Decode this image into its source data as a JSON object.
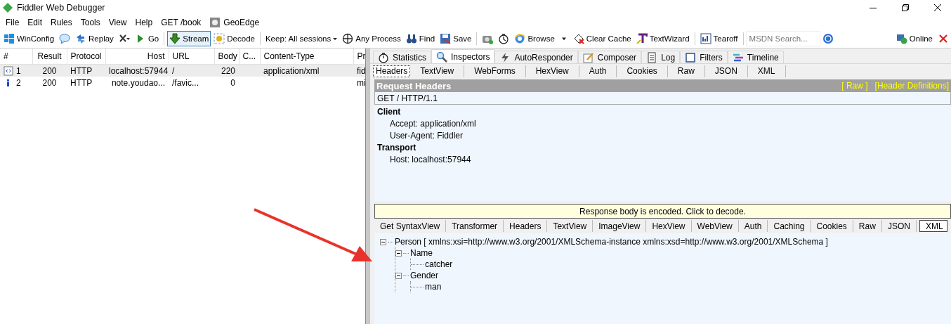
{
  "window": {
    "title": "Fiddler Web Debugger"
  },
  "menu": [
    {
      "kind": "menu",
      "label": "File"
    },
    {
      "kind": "menu",
      "label": "Edit"
    },
    {
      "kind": "menu",
      "label": "Rules"
    },
    {
      "kind": "menu",
      "label": "Tools"
    },
    {
      "kind": "menu",
      "label": "View"
    },
    {
      "kind": "menu",
      "label": "Help"
    },
    {
      "kind": "menu",
      "label": "GET /book"
    },
    {
      "kind": "icon",
      "label": "GeoEdge"
    }
  ],
  "toolbar": [
    {
      "kind": "button",
      "label": "WinConfig"
    },
    {
      "kind": "icon"
    },
    {
      "kind": "button",
      "label": "Replay"
    },
    {
      "kind": "menu-icon"
    },
    {
      "kind": "button",
      "label": "Go"
    },
    {
      "kind": "separator"
    },
    {
      "kind": "toggle",
      "label": "Stream",
      "selected": true
    },
    {
      "kind": "toggle",
      "label": "Decode",
      "selected": false
    },
    {
      "kind": "separator"
    },
    {
      "kind": "dropdown",
      "label": "Keep: All sessions"
    },
    {
      "kind": "button",
      "label": "Any Process"
    },
    {
      "kind": "button",
      "label": "Find"
    },
    {
      "kind": "button",
      "label": "Save"
    },
    {
      "kind": "separator"
    },
    {
      "kind": "icon"
    },
    {
      "kind": "icon"
    },
    {
      "kind": "button",
      "label": "Browse"
    },
    {
      "kind": "menu-icon"
    },
    {
      "kind": "button",
      "label": "Clear Cache"
    },
    {
      "kind": "button",
      "label": "TextWizard"
    },
    {
      "kind": "separator"
    },
    {
      "kind": "button",
      "label": "Tearoff"
    },
    {
      "kind": "separator"
    },
    {
      "kind": "field",
      "placeholder": "MSDN Search..."
    },
    {
      "kind": "icon"
    },
    {
      "kind": "spacer"
    },
    {
      "kind": "button",
      "label": "Online"
    },
    {
      "kind": "icon"
    }
  ],
  "sessions": {
    "columns": [
      {
        "label": "#"
      },
      {
        "label": "Result"
      },
      {
        "label": "Protocol"
      },
      {
        "label": "Host"
      },
      {
        "label": "URL"
      },
      {
        "label": "Body"
      },
      {
        "label": "C..."
      },
      {
        "label": "Content-Type"
      },
      {
        "label": "Pr"
      }
    ],
    "rows": [
      {
        "kind": "xml",
        "selected": true,
        "cells": [
          "1",
          "200",
          "HTTP",
          "localhost:57944",
          "/",
          "220",
          "",
          "application/xml",
          "fid"
        ]
      },
      {
        "kind": "info",
        "selected": false,
        "cells": [
          "2",
          "200",
          "HTTP",
          "note.youdao...",
          "/favic...",
          "0",
          "",
          "",
          "mi"
        ]
      }
    ]
  },
  "tabs": [
    {
      "label": "Statistics",
      "selected": false
    },
    {
      "label": "Inspectors",
      "selected": true
    },
    {
      "label": "AutoResponder",
      "selected": false
    },
    {
      "label": "Composer",
      "selected": false
    },
    {
      "label": "Log",
      "selected": false
    },
    {
      "label": "Filters",
      "selected": false
    },
    {
      "label": "Timeline",
      "selected": false
    }
  ],
  "request": {
    "tabs": [
      {
        "label": "Headers",
        "selected": true
      },
      {
        "label": "TextView",
        "selected": false
      },
      {
        "label": "WebForms",
        "selected": false
      },
      {
        "label": "HexView",
        "selected": false
      },
      {
        "label": "Auth",
        "selected": false
      },
      {
        "label": "Cookies",
        "selected": false
      },
      {
        "label": "Raw",
        "selected": false
      },
      {
        "label": "JSON",
        "selected": false
      },
      {
        "label": "XML",
        "selected": false
      }
    ],
    "title": "Request Headers",
    "links": [
      "[ Raw ]",
      "[Header Definitions]"
    ],
    "request_line": "GET / HTTP/1.1",
    "groups": [
      {
        "name": "Client",
        "headers": [
          "Accept: application/xml",
          "User-Agent: Fiddler"
        ]
      },
      {
        "name": "Transport",
        "headers": [
          "Host: localhost:57944"
        ]
      }
    ]
  },
  "response": {
    "banner": "Response body is encoded. Click to decode.",
    "tabs": [
      {
        "label": "Get SyntaxView",
        "selected": false
      },
      {
        "label": "Transformer",
        "selected": false
      },
      {
        "label": "Headers",
        "selected": false
      },
      {
        "label": "TextView",
        "selected": false
      },
      {
        "label": "ImageView",
        "selected": false
      },
      {
        "label": "HexView",
        "selected": false
      },
      {
        "label": "WebView",
        "selected": false
      },
      {
        "label": "Auth",
        "selected": false
      },
      {
        "label": "Caching",
        "selected": false
      },
      {
        "label": "Cookies",
        "selected": false
      },
      {
        "label": "Raw",
        "selected": false
      },
      {
        "label": "JSON",
        "selected": false
      },
      {
        "label": "XML",
        "selected": true
      }
    ],
    "tree": [
      {
        "label": "Person [ xmlns:xsi=http://www.w3.org/2001/XMLSchema-instance xmlns:xsd=http://www.w3.org/2001/XMLSchema ]",
        "expanded": true,
        "children": [
          {
            "label": "Name",
            "expanded": true,
            "children": [
              {
                "label": "catcher"
              }
            ]
          },
          {
            "label": "Gender",
            "expanded": true,
            "children": [
              {
                "label": "man"
              }
            ]
          }
        ]
      }
    ]
  }
}
